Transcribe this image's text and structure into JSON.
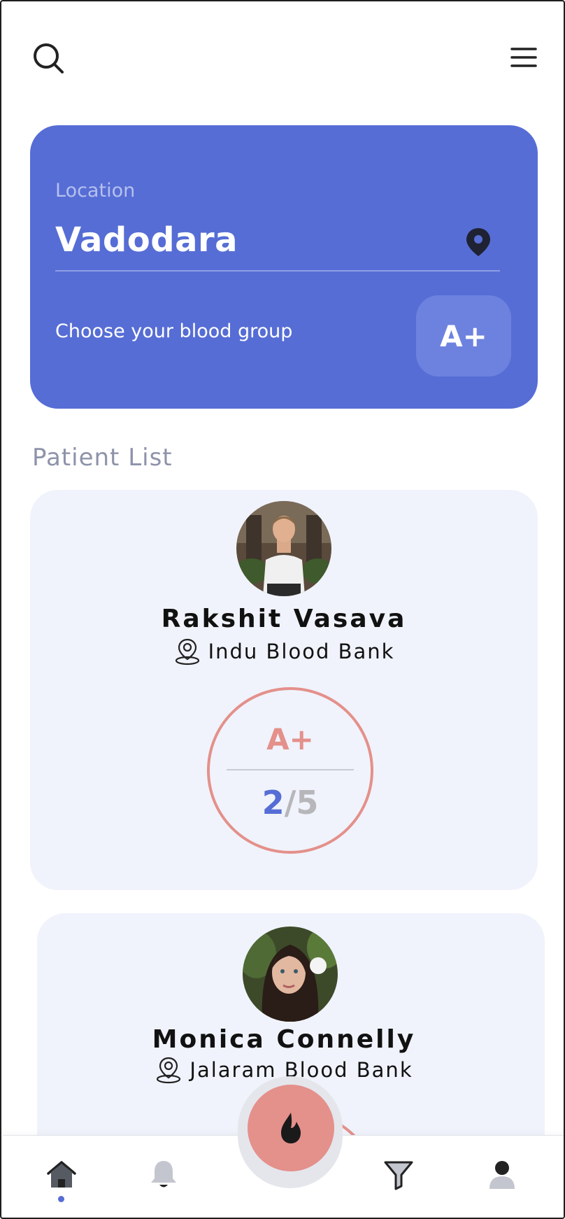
{
  "header": {
    "search_icon": "search-icon",
    "menu_icon": "hamburger-menu-icon"
  },
  "location_card": {
    "label": "Location",
    "value": "Vadodara",
    "pin_icon": "map-pin-icon",
    "blood_group_label": "Choose your blood group",
    "blood_group_value": "A+"
  },
  "patient_list": {
    "title": "Patient List",
    "patients": [
      {
        "name": "Rakshit Vasava",
        "bank": "Indu Blood Bank",
        "blood_type": "A+",
        "units_current": "2",
        "units_separator": "/",
        "units_total": "5"
      },
      {
        "name": "Monica Connelly",
        "bank": "Jalaram Blood Bank"
      }
    ]
  },
  "bottom_nav": {
    "items": [
      "home-icon",
      "bell-icon",
      "blood-drop-icon",
      "filter-icon",
      "user-icon"
    ],
    "active": "home"
  },
  "colors": {
    "accent": "#566dd5",
    "blood": "#e4908b",
    "card_bg": "#f0f3fb"
  }
}
